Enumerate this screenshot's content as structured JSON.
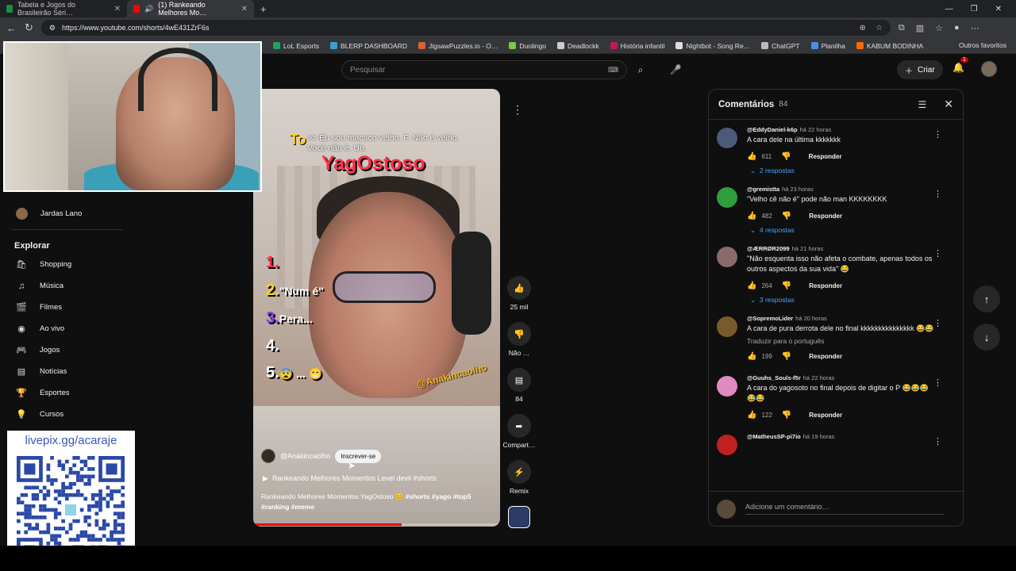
{
  "browser": {
    "tabs": [
      {
        "title": "Tabela e Jogos do Brasileirão Séri…",
        "color": "#1e8e3e",
        "active": false
      },
      {
        "title": "(1) Rankeando Melhores Mo…",
        "color": "#ff0000",
        "active": true
      }
    ],
    "new_tab": "+",
    "url": "https://www.youtube.com/shorts/4wE431ZrF6s",
    "bookmarks": [
      "LoL Esports",
      "BLERP DASHBOARD",
      "JigsawPuzzles.io - O…",
      "Duolingo",
      "Deadlockk",
      "História infantil",
      "Nightbot - Song Re…",
      "ChatGPT",
      "Planilha",
      "KABUM BODINHA"
    ],
    "bookmark_colors": [
      "#1ea362",
      "#3a9bdc",
      "#e06030",
      "#7bc843",
      "#cccccc",
      "#c2185b",
      "#dddddd",
      "#bbbbbb",
      "#4a90e2",
      "#ff6a00"
    ],
    "other_bookmarks": "Outros favoritos"
  },
  "header": {
    "search_placeholder": "Pesquisar",
    "create_label": "Criar",
    "notif_count": "1"
  },
  "sidebar": {
    "subscription": "Jardas Lano",
    "explore_heading": "Explorar",
    "items": [
      {
        "label": "Shopping",
        "icon": "bag-icon",
        "glyph": "🛍"
      },
      {
        "label": "Música",
        "icon": "music-icon",
        "glyph": "♫"
      },
      {
        "label": "Filmes",
        "icon": "film-icon",
        "glyph": "🎬"
      },
      {
        "label": "Ao vivo",
        "icon": "live-icon",
        "glyph": "◉"
      },
      {
        "label": "Jogos",
        "icon": "gamepad-icon",
        "glyph": "🎮"
      },
      {
        "label": "Notícias",
        "icon": "news-icon",
        "glyph": "▤"
      },
      {
        "label": "Esportes",
        "icon": "trophy-icon",
        "glyph": "🏆"
      },
      {
        "label": "Cursos",
        "icon": "bulb-icon",
        "glyph": "💡"
      }
    ]
  },
  "overlay": {
    "qr_label": "livepix.gg/acaraje"
  },
  "video": {
    "caption_to": "To",
    "caption_line1": ">> Eu sou macaco velho. F. Não é velho.",
    "caption_line2": "Você não é. Uh.",
    "overlay_title": "YagOstoso",
    "ranks": [
      {
        "n": "1.",
        "text": "",
        "color": "#ff2e4a"
      },
      {
        "n": "2.",
        "text": "\"Num é\"",
        "color": "#ffd21a"
      },
      {
        "n": "3.",
        "text": "Pera...",
        "color": "#8a3cff"
      },
      {
        "n": "4.",
        "text": "",
        "color": "#ffffff"
      },
      {
        "n": "5.",
        "text": "😨 ... 😁",
        "color": "#ffffff"
      }
    ],
    "watermark": "@Anakincaolho",
    "channel": "@Anakincaolho",
    "subscribe": "Inscrever-se",
    "title": "Rankeando Melhores Momentos Level devil #shorts",
    "desc_plain": "Rankeando Melhores Momentos YagOstoso 😊",
    "desc_tags": "#shorts #yago #top5 #ranking #meme",
    "progress": 0.6
  },
  "actions": {
    "likes": "25 mil",
    "dislike": "Não …",
    "comments": "84",
    "share": "Compart…",
    "remix": "Remix"
  },
  "comments": {
    "title": "Comentários",
    "count": "84",
    "reply_label": "Responder",
    "add_placeholder": "Adicione um comentário…",
    "items": [
      {
        "user": "@EddyDaniel-k6p",
        "time": "há 22 horas",
        "text": "A cara dele na última kkkkkkk",
        "likes": "611",
        "replies": "2 respostas",
        "translate": "",
        "color": "#4a5a78"
      },
      {
        "user": "@gremistta",
        "time": "há 23 horas",
        "text": "\"Velho cê não é\" pode não man KKKKKKKK",
        "likes": "482",
        "replies": "4 respostas",
        "translate": "",
        "color": "#2e9e3e"
      },
      {
        "user": "@ÆRRØR2099",
        "time": "há 21 horas",
        "text": "\"Não esquenta isso não afeta o combate, apenas todos os outros aspectos da sua vida\" 😂",
        "likes": "264",
        "replies": "3 respostas",
        "translate": "",
        "color": "#8a6a6a"
      },
      {
        "user": "@SopremoLider",
        "time": "há 20 horas",
        "text": "A cara de pura derrota dele no final kkkkkkkkkkkkkkk 😂😂",
        "likes": "199",
        "replies": "",
        "translate": "Traduzir para o português",
        "color": "#7a5a2a"
      },
      {
        "user": "@Guuhs_Souls-f5r",
        "time": "há 22 horas",
        "text": "A cara do yagosoto no final depois de digitar o P 😂😂😂😂😂",
        "likes": "122",
        "replies": "",
        "translate": "",
        "color": "#e08ac0"
      },
      {
        "user": "@MatheusSP-pi7io",
        "time": "há 19 horas",
        "text": "",
        "likes": "",
        "replies": "",
        "translate": "",
        "color": "#c02020"
      }
    ]
  }
}
